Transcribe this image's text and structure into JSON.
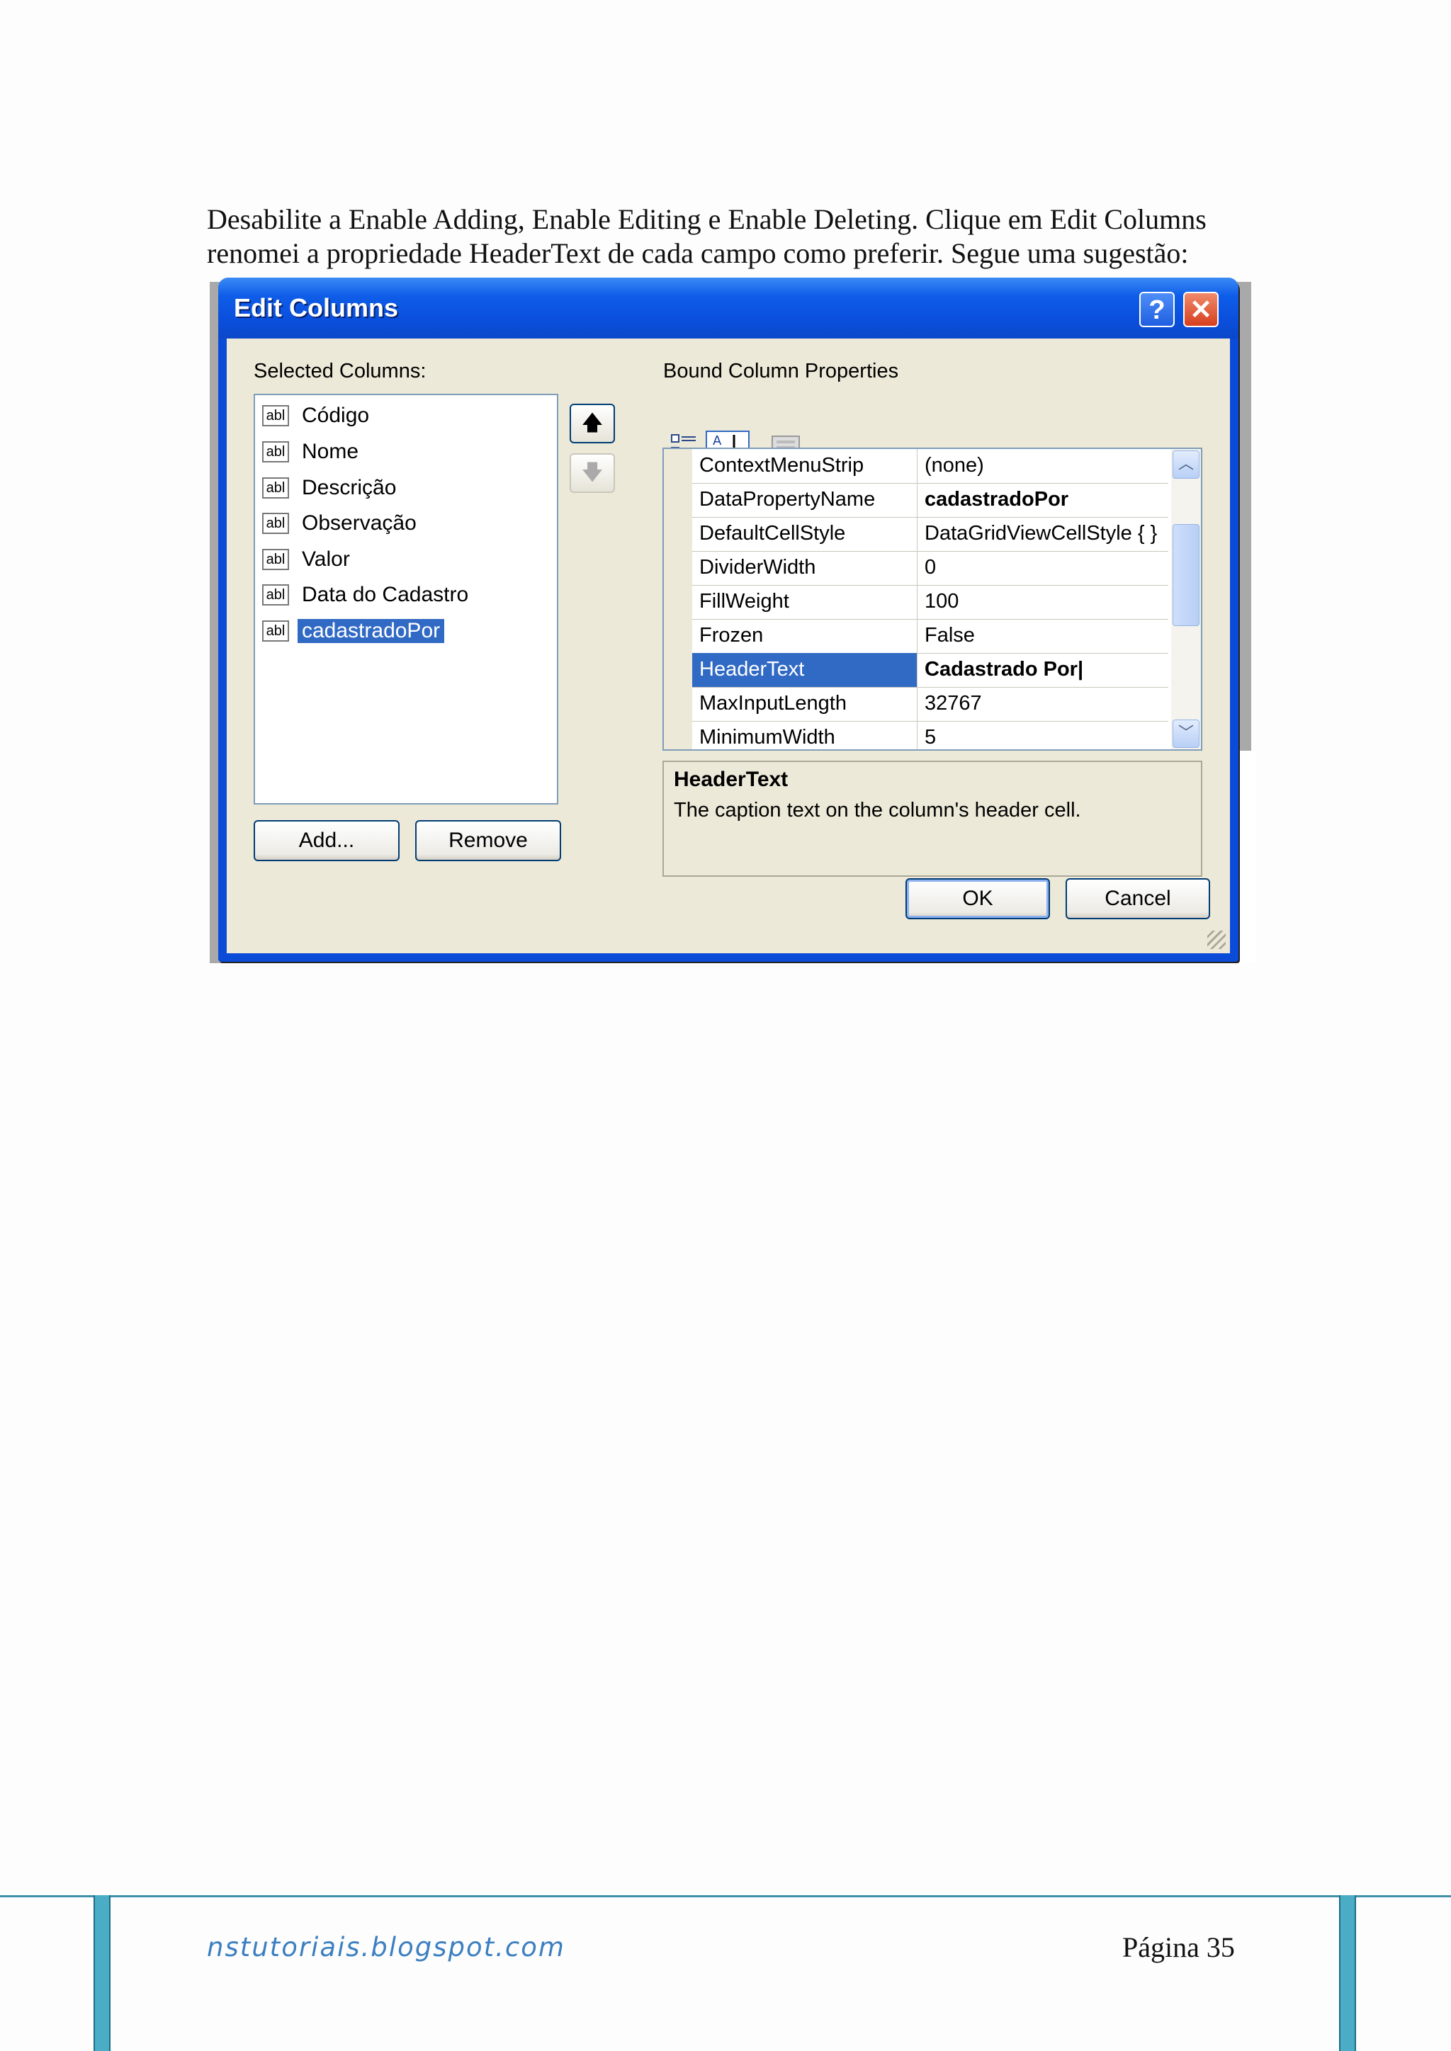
{
  "intro": {
    "line1": "Desabilite a Enable Adding, Enable Editing e Enable Deleting. Clique em Edit Columns",
    "line2": "renomei a propriedade HeaderText de cada campo como preferir. Segue uma sugestão:"
  },
  "dialog": {
    "title": "Edit Columns",
    "help_glyph": "?",
    "close_glyph": "✕",
    "selected_columns_label": "Selected Columns:",
    "bound_properties_label": "Bound Column Properties",
    "column_type_tag": "abl",
    "columns": [
      {
        "label": "Código"
      },
      {
        "label": "Nome"
      },
      {
        "label": "Descrição"
      },
      {
        "label": "Observação"
      },
      {
        "label": "Valor"
      },
      {
        "label": "Data do Cadastro"
      },
      {
        "label": "cadastradoPor",
        "selected": true
      }
    ],
    "move_up_glyph": "🡅",
    "move_down_glyph": "🡇",
    "add_label": "Add...",
    "remove_label": "Remove",
    "properties": [
      {
        "name": "ContextMenuStrip",
        "value": "(none)"
      },
      {
        "name": "DataPropertyName",
        "value": "cadastradoPor"
      },
      {
        "name": "DefaultCellStyle",
        "value": "DataGridViewCellStyle { }"
      },
      {
        "name": "DividerWidth",
        "value": "0"
      },
      {
        "name": "FillWeight",
        "value": "100"
      },
      {
        "name": "Frozen",
        "value": "False"
      },
      {
        "name": "HeaderText",
        "value": "Cadastrado Por|"
      },
      {
        "name": "MaxInputLength",
        "value": "32767"
      },
      {
        "name": "MinimumWidth",
        "value": "5"
      }
    ],
    "help_title": "HeaderText",
    "help_description": "The caption text on the column's header cell.",
    "ok_label": "OK",
    "cancel_label": "Cancel",
    "colors": {
      "titlebar": "#0a4fdc",
      "selection": "#316ac5",
      "face": "#ece9d8"
    }
  },
  "footer": {
    "site": "nstutoriais.blogspot.com",
    "page": "Página 35"
  }
}
